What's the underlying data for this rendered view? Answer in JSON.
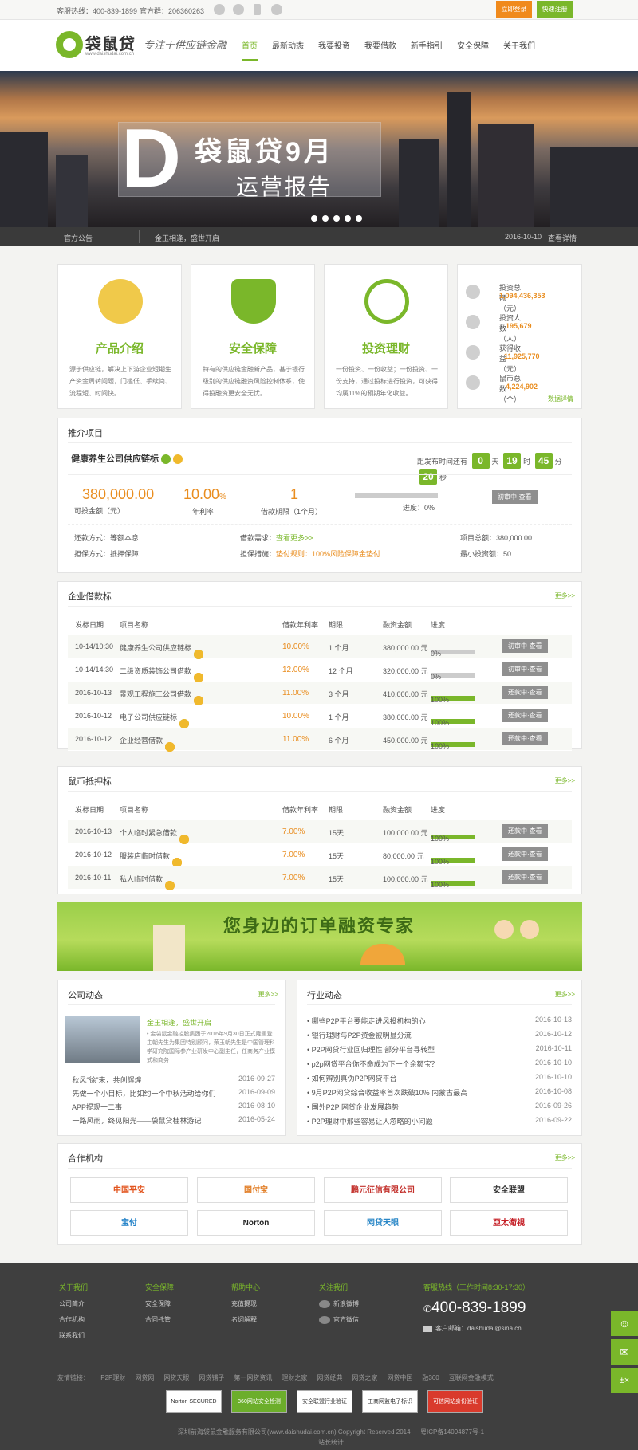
{
  "top": {
    "hotline": "客服热线：400-839-1899",
    "qq": "官方群：206360263",
    "login": "立即登录",
    "register": "快速注册"
  },
  "logo": {
    "name": "袋鼠贷",
    "url": "www.daishudai.com.cn",
    "slogan": "专注于供应链金融"
  },
  "nav": [
    "首页",
    "最新动态",
    "我要投资",
    "我要借款",
    "新手指引",
    "安全保障",
    "关于我们"
  ],
  "banner": {
    "letter": "D",
    "title": "袋鼠贷9月",
    "subtitle": "运营报告"
  },
  "notice": {
    "label": "官方公告",
    "message": "金玉相逢，盛世开启",
    "date": "2016-10-10",
    "link": "查看详情"
  },
  "features": [
    {
      "title": "产品介绍",
      "desc": "源于供应链，解决上下游企业短期生产资金周转问题，门槛低、手续简、流程短、时间快。"
    },
    {
      "title": "安全保障",
      "desc": "特有的供应链金融新产品，基于银行级别的供应链融资风险控制体系，使得投融资更安全无忧。"
    },
    {
      "title": "投资理财",
      "desc": "一份投资、一份收益；一份投资、一份支持，通过投标进行投资，可获得均属11%的预期年化收益。"
    }
  ],
  "stats": {
    "items": [
      {
        "label": "投资总额（元）",
        "value": "1,094,436,353"
      },
      {
        "label": "投资人数（人）",
        "value": "195,679"
      },
      {
        "label": "获得收益（元）",
        "value": "11,925,770"
      },
      {
        "label": "鼠币总数（个）",
        "value": "4,224,902"
      }
    ],
    "more": "数据详情"
  },
  "recommend": {
    "section": "推介项目",
    "name": "健康养生公司供应链标",
    "countdown_label": "距发布时间还有",
    "cd": [
      "0",
      "19",
      "45",
      "20"
    ],
    "units": [
      "天",
      "时",
      "分",
      "秒"
    ],
    "amount": "380,000.00",
    "amount_label": "可投金额（元）",
    "rate": "10.00",
    "rate_unit": "%",
    "rate_label": "年利率",
    "term": "1",
    "term_label": "借款期限（1个月）",
    "progress_label": "进度：0%",
    "btn": "初审中·查看",
    "repay": "还款方式：等额本息",
    "guarantee": "担保方式：抵押保障",
    "need_label": "借款需求：",
    "need": "查看更多>>",
    "protect_label": "担保措施：",
    "protect": "垫付规则：100%风险保障金垫付",
    "total": "项目总额：380,000.00",
    "min": "最小投资额：50"
  },
  "enterprise": {
    "title": "企业借款标",
    "more": "更多>>",
    "headers": [
      "发标日期",
      "项目名称",
      "借款年利率",
      "期限",
      "融资金额",
      "进度"
    ],
    "rows": [
      {
        "date": "10-14/10:30",
        "name": "健康养生公司供应链标",
        "rate": "10.00%",
        "term": "1 个月",
        "amount": "380,000.00 元",
        "pct": "0%",
        "fill": 0,
        "btn": "初审中·查看"
      },
      {
        "date": "10-14/14:30",
        "name": "二级资质装饰公司借款",
        "rate": "12.00%",
        "term": "12 个月",
        "amount": "320,000.00 元",
        "pct": "0%",
        "fill": 0,
        "btn": "初审中·查看"
      },
      {
        "date": "2016-10-13",
        "name": "景观工程施工公司借款",
        "rate": "11.00%",
        "term": "3 个月",
        "amount": "410,000.00 元",
        "pct": "100%",
        "fill": 1,
        "btn": "还款中·查看"
      },
      {
        "date": "2016-10-12",
        "name": "电子公司供应链标",
        "rate": "10.00%",
        "term": "1 个月",
        "amount": "380,000.00 元",
        "pct": "100%",
        "fill": 1,
        "btn": "还款中·查看"
      },
      {
        "date": "2016-10-12",
        "name": "企业经营借款",
        "rate": "11.00%",
        "term": "6 个月",
        "amount": "450,000.00 元",
        "pct": "100%",
        "fill": 1,
        "btn": "还款中·查看"
      }
    ]
  },
  "coin": {
    "title": "鼠币抵押标",
    "more": "更多>>",
    "headers": [
      "发标日期",
      "项目名称",
      "借款年利率",
      "期限",
      "融资金额",
      "进度"
    ],
    "rows": [
      {
        "date": "2016-10-13",
        "name": "个人临时紧急借款",
        "rate": "7.00%",
        "term": "15天",
        "amount": "100,000.00 元",
        "pct": "100%",
        "fill": 1,
        "btn": "还款中·查看"
      },
      {
        "date": "2016-10-12",
        "name": "服装店临时借款",
        "rate": "7.00%",
        "term": "15天",
        "amount": "80,000.00 元",
        "pct": "100%",
        "fill": 1,
        "btn": "还款中·查看"
      },
      {
        "date": "2016-10-11",
        "name": "私人临时借款",
        "rate": "7.00%",
        "term": "15天",
        "amount": "100,000.00 元",
        "pct": "100%",
        "fill": 1,
        "btn": "还款中·查看"
      }
    ]
  },
  "promo": "您身边的订单融资专家",
  "company_news": {
    "title": "公司动态",
    "more": "更多>>",
    "headline": "金玉相逢，盛世开启",
    "summary": "• 金袋鼠金融控股集团于2016年9月30日正式隆重登主朝先生为集团特别顾问，荣玉朝先生是中国管理科学研究院国际参产业研发中心副主任，任商务产业模式和商务",
    "items": [
      {
        "t": "· 秋风“徐”来，共创辉煌",
        "d": "2016-09-27"
      },
      {
        "t": "· 先做一个小目标，比如约一个中秋活动给你们",
        "d": "2016-09-09"
      },
      {
        "t": "· APP提现一二事",
        "d": "2016-08-10"
      },
      {
        "t": "· 一路风雨，终见阳光——袋鼠贷桂林游记",
        "d": "2016-05-24"
      }
    ]
  },
  "industry": {
    "title": "行业动态",
    "more": "更多>>",
    "items": [
      {
        "t": "• 哪些P2P平台要能走进风投机构的心",
        "d": "2016-10-13"
      },
      {
        "t": "• 银行理财与P2P资金被明显分流",
        "d": "2016-10-12"
      },
      {
        "t": "• P2P网贷行业回归理性 部分平台寻转型",
        "d": "2016-10-11"
      },
      {
        "t": "• p2p网贷平台你不命成为下一个余额宝？",
        "d": "2016-10-10"
      },
      {
        "t": "• 如何辨别真伪P2P网贷平台",
        "d": "2016-10-10"
      },
      {
        "t": "• 9月P2P网贷综合收益率首次跌破10% 内蒙古最高",
        "d": "2016-10-08"
      },
      {
        "t": "• 国外P2P 网贷企业发展趋势",
        "d": "2016-09-26"
      },
      {
        "t": "• P2P理财中那些容易让人忽略的小问题",
        "d": "2016-09-22"
      }
    ]
  },
  "partners": {
    "title": "合作机构",
    "more": "更多>>",
    "items": [
      "中国平安",
      "国付宝",
      "鹏元征信有限公司",
      "安全联盟",
      "宝付",
      "Norton",
      "网贷天眼",
      "亞太衛視"
    ]
  },
  "footer": {
    "cols": [
      {
        "h": "关于我们",
        "items": [
          "公司简介",
          "合作机构",
          "联系我们"
        ]
      },
      {
        "h": "安全保障",
        "items": [
          "安全保障",
          "合同托管"
        ]
      },
      {
        "h": "帮助中心",
        "items": [
          "充值提现",
          "名词解释"
        ]
      },
      {
        "h": "关注我们",
        "items": [
          "新浪微博",
          "官方微信"
        ]
      }
    ],
    "hotline_label": "客服热线（工作时间8:30-17:30）",
    "hotline": "400-839-1899",
    "email": "客户邮箱：daishudai@sina.cn",
    "links_label": "友情链接：",
    "links": [
      "P2P理财",
      "网贷网",
      "网贷天眼",
      "网贷铺子",
      "第一网贷资讯",
      "理财之家",
      "网贷经典",
      "网贷之家",
      "网贷中国",
      "融360",
      "互联网金融模式"
    ],
    "certs": [
      "Norton SECURED",
      "360网站安全检测",
      "安全联盟行业验证",
      "工商网监电子标识",
      "可信网站身份验证"
    ],
    "copy": "深圳前海袋鼠金融服务有限公司(www.daishudai.com.cn) Copyright Reserved 2014 ｜ 粤ICP备14094877号-1",
    "stat": "站长统计"
  }
}
